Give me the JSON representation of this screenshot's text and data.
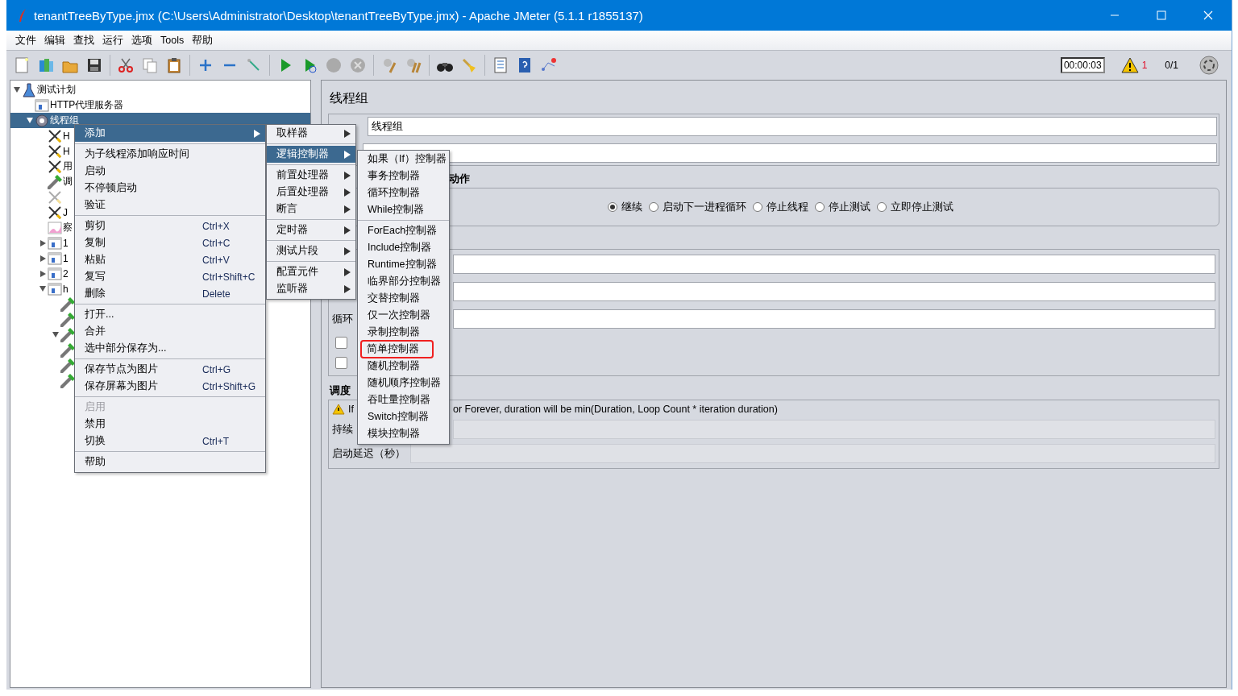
{
  "window": {
    "title": "tenantTreeByType.jmx (C:\\Users\\Administrator\\Desktop\\tenantTreeByType.jmx) - Apache JMeter (5.1.1 r1855137)"
  },
  "menu_bar": [
    {
      "label": "文件"
    },
    {
      "label": "编辑"
    },
    {
      "label": "查找"
    },
    {
      "label": "运行"
    },
    {
      "label": "选项"
    },
    {
      "label": "Tools"
    },
    {
      "label": "帮助"
    }
  ],
  "status": {
    "elapsed": "00:00:03",
    "warnings": "1",
    "threads": "0/1"
  },
  "tree": [
    {
      "label": "测试计划",
      "kind": "plan",
      "expanded": true,
      "selected": false,
      "children": [
        {
          "label": "HTTP代理服务器",
          "kind": "proxy",
          "selected": false
        },
        {
          "label": "线程组",
          "kind": "threadgroup",
          "expanded": true,
          "selected": true,
          "children": [
            {
              "label": "H",
              "kind": "tool",
              "selected": false,
              "disabled": false
            },
            {
              "label": "H",
              "kind": "tool",
              "selected": false,
              "disabled": false
            },
            {
              "label": "用",
              "kind": "tool",
              "selected": false,
              "disabled": false
            },
            {
              "label": "调",
              "kind": "pipette",
              "selected": false,
              "disabled": false
            },
            {
              "kind": "tool",
              "selected": false,
              "disabled": true
            },
            {
              "label": "J",
              "kind": "tool",
              "selected": false,
              "disabled": false
            },
            {
              "label": "察",
              "kind": "graph",
              "selected": false,
              "disabled": false
            },
            {
              "label": "1",
              "kind": "fragment",
              "expanded": false,
              "selected": false,
              "disabled": false
            },
            {
              "label": "1",
              "kind": "fragment",
              "expanded": false,
              "selected": false,
              "disabled": false
            },
            {
              "label": "2",
              "kind": "fragment",
              "expanded": false,
              "selected": false,
              "disabled": false
            },
            {
              "label": "h",
              "kind": "fragment",
              "expanded": true,
              "selected": false,
              "disabled": false,
              "children": [
                {
                  "kind": "pipette",
                  "selected": false
                },
                {
                  "kind": "pipette",
                  "selected": false
                },
                {
                  "kind": "pipette",
                  "expanded": true,
                  "selected": false
                },
                {
                  "kind": "pipette",
                  "selected": false
                },
                {
                  "kind": "pipette",
                  "selected": false
                },
                {
                  "kind": "pipette",
                  "selected": false
                }
              ]
            }
          ]
        }
      ]
    }
  ],
  "panel": {
    "title": "线程组",
    "name_value": "线程组",
    "action_heading": "动作",
    "actions": [
      {
        "label": "继续",
        "selected": true
      },
      {
        "label": "启动下一进程循环",
        "selected": false
      },
      {
        "label": "停止线程",
        "selected": false
      },
      {
        "label": "停止测试",
        "selected": false
      },
      {
        "label": "立即停止测试",
        "selected": false
      }
    ],
    "loop_label": "循环",
    "checkboxes": [
      {
        "checked": false
      },
      {
        "checked": false
      }
    ],
    "schedule_heading": "调度",
    "warning_start": "If",
    "warning_end": "or Forever, duration will be min(Duration, Loop Count * iteration duration)",
    "duration_label": "持续",
    "delay_label": "启动延迟（秒）"
  },
  "context_menu": {
    "items": [
      {
        "kind": "item",
        "label": "添加",
        "submenu": true,
        "selected": true,
        "disabled": false
      },
      {
        "kind": "separator"
      },
      {
        "kind": "item",
        "label": "为子线程添加响应时间",
        "selected": false,
        "disabled": false
      },
      {
        "kind": "item",
        "label": "启动",
        "selected": false,
        "disabled": false
      },
      {
        "kind": "item",
        "label": "不停顿启动",
        "selected": false,
        "disabled": false
      },
      {
        "kind": "item",
        "label": "验证",
        "selected": false,
        "disabled": false
      },
      {
        "kind": "separator"
      },
      {
        "kind": "item",
        "label": "剪切",
        "shortcut": "Ctrl+X",
        "selected": false,
        "disabled": false
      },
      {
        "kind": "item",
        "label": "复制",
        "shortcut": "Ctrl+C",
        "selected": false,
        "disabled": false
      },
      {
        "kind": "item",
        "label": "粘贴",
        "shortcut": "Ctrl+V",
        "selected": false,
        "disabled": false
      },
      {
        "kind": "item",
        "label": "复写",
        "shortcut": "Ctrl+Shift+C",
        "selected": false,
        "disabled": false
      },
      {
        "kind": "item",
        "label": "删除",
        "shortcut": "Delete",
        "selected": false,
        "disabled": false
      },
      {
        "kind": "separator"
      },
      {
        "kind": "item",
        "label": "打开...",
        "selected": false,
        "disabled": false
      },
      {
        "kind": "item",
        "label": "合并",
        "selected": false,
        "disabled": false
      },
      {
        "kind": "item",
        "label": "选中部分保存为...",
        "selected": false,
        "disabled": false
      },
      {
        "kind": "separator"
      },
      {
        "kind": "item",
        "label": "保存节点为图片",
        "shortcut": "Ctrl+G",
        "selected": false,
        "disabled": false
      },
      {
        "kind": "item",
        "label": "保存屏幕为图片",
        "shortcut": "Ctrl+Shift+G",
        "selected": false,
        "disabled": false
      },
      {
        "kind": "separator"
      },
      {
        "kind": "item",
        "label": "启用",
        "selected": false,
        "disabled": true
      },
      {
        "kind": "item",
        "label": "禁用",
        "selected": false,
        "disabled": false
      },
      {
        "kind": "item",
        "label": "切换",
        "shortcut": "Ctrl+T",
        "selected": false,
        "disabled": false
      },
      {
        "kind": "separator"
      },
      {
        "kind": "item",
        "label": "帮助",
        "selected": false,
        "disabled": false
      }
    ]
  },
  "add_menu": {
    "items": [
      {
        "kind": "item",
        "label": "取样器",
        "submenu": true,
        "selected": false
      },
      {
        "kind": "separator"
      },
      {
        "kind": "item",
        "label": "逻辑控制器",
        "submenu": true,
        "selected": true
      },
      {
        "kind": "separator"
      },
      {
        "kind": "item",
        "label": "前置处理器",
        "submenu": true,
        "selected": false
      },
      {
        "kind": "item",
        "label": "后置处理器",
        "submenu": true,
        "selected": false
      },
      {
        "kind": "item",
        "label": "断言",
        "submenu": true,
        "selected": false
      },
      {
        "kind": "separator"
      },
      {
        "kind": "item",
        "label": "定时器",
        "submenu": true,
        "selected": false
      },
      {
        "kind": "separator"
      },
      {
        "kind": "item",
        "label": "测试片段",
        "submenu": true,
        "selected": false
      },
      {
        "kind": "separator"
      },
      {
        "kind": "item",
        "label": "配置元件",
        "submenu": true,
        "selected": false
      },
      {
        "kind": "item",
        "label": "监听器",
        "submenu": true,
        "selected": false
      }
    ]
  },
  "controller_menu": {
    "items": [
      {
        "kind": "item",
        "label": "如果（If）控制器",
        "annotated": false
      },
      {
        "kind": "item",
        "label": "事务控制器",
        "annotated": false
      },
      {
        "kind": "item",
        "label": "循环控制器",
        "annotated": false
      },
      {
        "kind": "item",
        "label": "While控制器",
        "annotated": false
      },
      {
        "kind": "separator"
      },
      {
        "kind": "item",
        "label": "ForEach控制器",
        "annotated": false
      },
      {
        "kind": "item",
        "label": "Include控制器",
        "annotated": false
      },
      {
        "kind": "item",
        "label": "Runtime控制器",
        "annotated": false
      },
      {
        "kind": "item",
        "label": "临界部分控制器",
        "annotated": false
      },
      {
        "kind": "item",
        "label": "交替控制器",
        "annotated": false
      },
      {
        "kind": "item",
        "label": "仅一次控制器",
        "annotated": false
      },
      {
        "kind": "item",
        "label": "录制控制器",
        "annotated": false
      },
      {
        "kind": "item",
        "label": "简单控制器",
        "annotated": true
      },
      {
        "kind": "item",
        "label": "随机控制器",
        "annotated": false
      },
      {
        "kind": "item",
        "label": "随机顺序控制器",
        "annotated": false
      },
      {
        "kind": "item",
        "label": "吞吐量控制器",
        "annotated": false
      },
      {
        "kind": "item",
        "label": "Switch控制器",
        "annotated": false
      },
      {
        "kind": "item",
        "label": "模块控制器",
        "annotated": false
      }
    ]
  }
}
